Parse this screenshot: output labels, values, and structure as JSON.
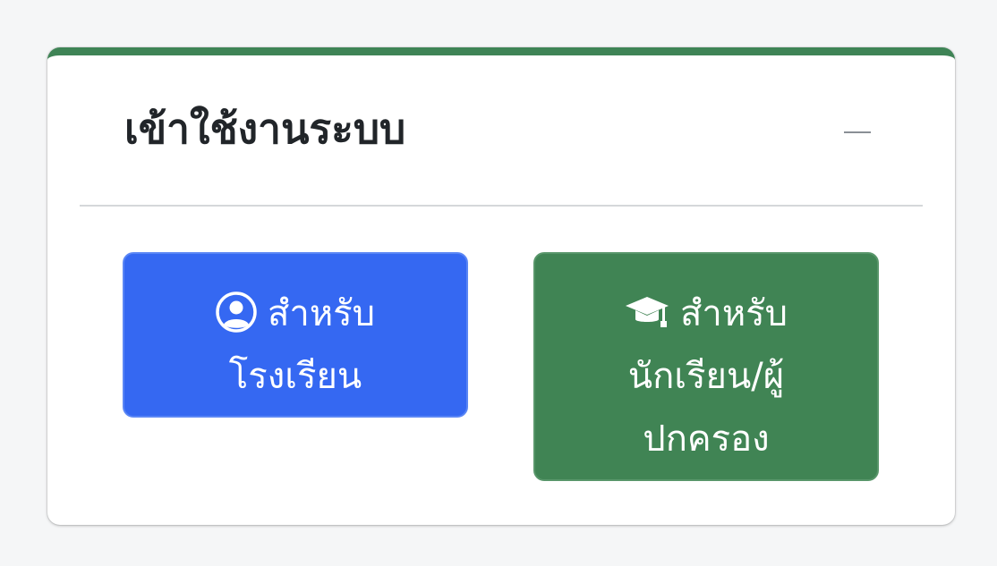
{
  "card": {
    "title": "เข้าใช้งานระบบ",
    "accent_color": "#3f8456"
  },
  "collapse_button": {
    "icon": "minus-icon"
  },
  "school_button": {
    "icon": "user-circle-icon",
    "line1": "สำหรับ",
    "line2": "โรงเรียน",
    "color": "#3568f2"
  },
  "student_button": {
    "icon": "graduation-cap-icon",
    "line1": "สำหรับ",
    "line2": "นักเรียน/ผู้",
    "line3": "ปกครอง",
    "color": "#408454"
  }
}
